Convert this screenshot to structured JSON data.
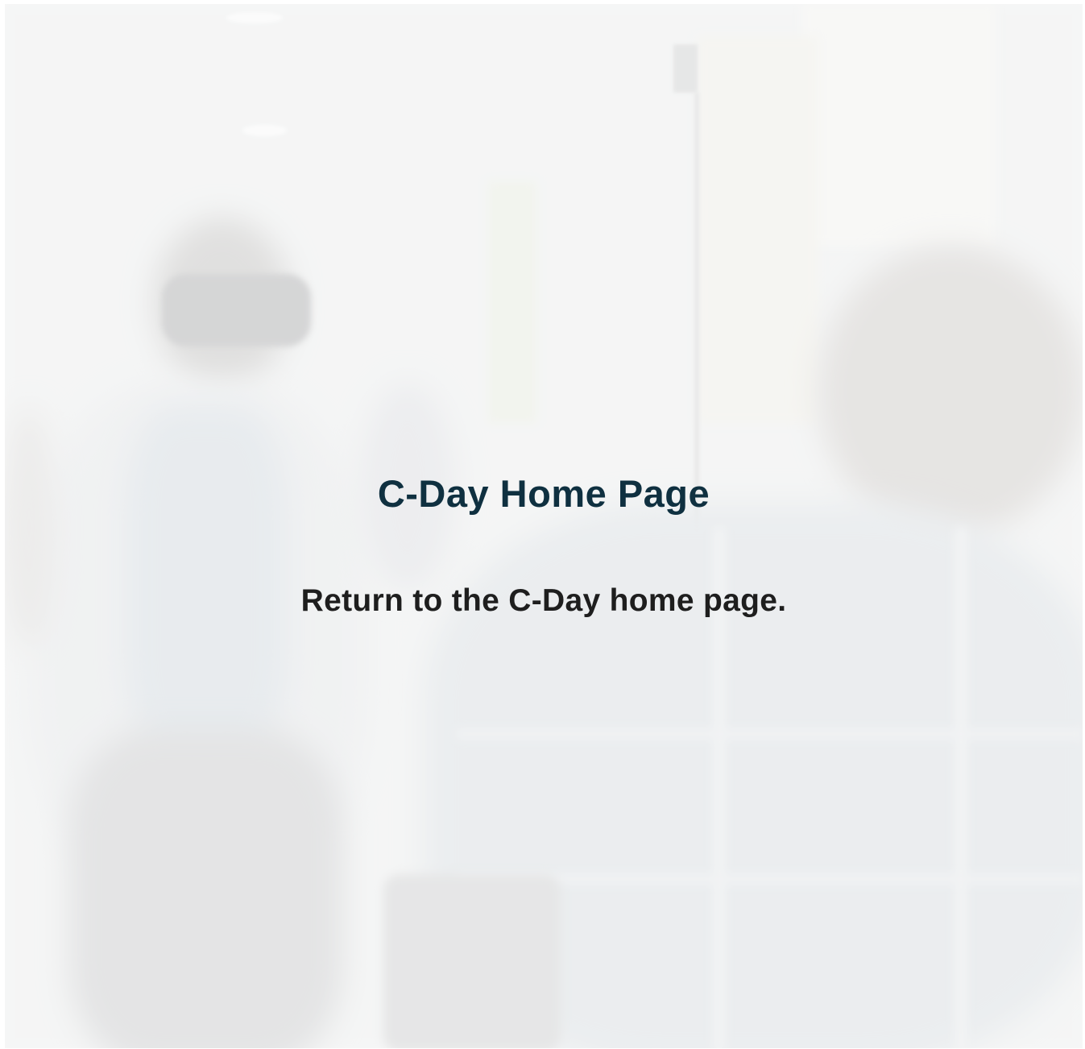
{
  "page": {
    "title": "C-Day Home Page",
    "subtitle": "Return to the C-Day home page.",
    "background_image": "faded-event-photo-vr-headset",
    "colors": {
      "title": "#0f3040",
      "subtitle": "#1e1e1e",
      "overlay": "#f8f9f9"
    }
  }
}
